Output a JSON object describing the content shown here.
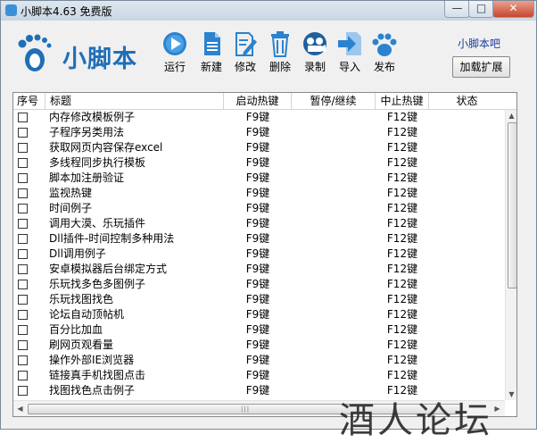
{
  "window": {
    "title": "小脚本4.63 免费版",
    "controls": {
      "minimize": "—",
      "maximize": "□",
      "close": "✕"
    }
  },
  "brand": {
    "logo_text": "小脚本",
    "logo_icon": "footprint-icon",
    "accent_color": "#1f6fb8"
  },
  "toolbar": [
    {
      "label": "运行",
      "icon": "play-icon"
    },
    {
      "label": "新建",
      "icon": "new-document-icon"
    },
    {
      "label": "修改",
      "icon": "edit-icon"
    },
    {
      "label": "删除",
      "icon": "trash-icon"
    },
    {
      "label": "录制",
      "icon": "record-icon"
    },
    {
      "label": "导入",
      "icon": "import-icon"
    },
    {
      "label": "发布",
      "icon": "publish-icon"
    }
  ],
  "side": {
    "link_label": "小脚本吧",
    "extension_button": "加载扩展"
  },
  "table": {
    "columns": [
      "序号",
      "标题",
      "启动热键",
      "暂停/继续",
      "中止热键",
      "状态"
    ],
    "rows": [
      {
        "title": "内存修改模板例子",
        "start": "F9键",
        "pause": "",
        "stop": "F12键",
        "status": ""
      },
      {
        "title": "子程序另类用法",
        "start": "F9键",
        "pause": "",
        "stop": "F12键",
        "status": ""
      },
      {
        "title": "获取网页内容保存excel",
        "start": "F9键",
        "pause": "",
        "stop": "F12键",
        "status": ""
      },
      {
        "title": "多线程同步执行模板",
        "start": "F9键",
        "pause": "",
        "stop": "F12键",
        "status": ""
      },
      {
        "title": "脚本加注册验证",
        "start": "F9键",
        "pause": "",
        "stop": "F12键",
        "status": ""
      },
      {
        "title": "监视热键",
        "start": "F9键",
        "pause": "",
        "stop": "F12键",
        "status": ""
      },
      {
        "title": "时间例子",
        "start": "F9键",
        "pause": "",
        "stop": "F12键",
        "status": ""
      },
      {
        "title": "调用大漠、乐玩插件",
        "start": "F9键",
        "pause": "",
        "stop": "F12键",
        "status": ""
      },
      {
        "title": "Dll插件-时间控制多种用法",
        "start": "F9键",
        "pause": "",
        "stop": "F12键",
        "status": ""
      },
      {
        "title": "Dll调用例子",
        "start": "F9键",
        "pause": "",
        "stop": "F12键",
        "status": ""
      },
      {
        "title": "安卓模拟器后台绑定方式",
        "start": "F9键",
        "pause": "",
        "stop": "F12键",
        "status": ""
      },
      {
        "title": "乐玩找多色多图例子",
        "start": "F9键",
        "pause": "",
        "stop": "F12键",
        "status": ""
      },
      {
        "title": "乐玩找图找色",
        "start": "F9键",
        "pause": "",
        "stop": "F12键",
        "status": ""
      },
      {
        "title": "论坛自动顶帖机",
        "start": "F9键",
        "pause": "",
        "stop": "F12键",
        "status": ""
      },
      {
        "title": "百分比加血",
        "start": "F9键",
        "pause": "",
        "stop": "F12键",
        "status": ""
      },
      {
        "title": "刷网页观看量",
        "start": "F9键",
        "pause": "",
        "stop": "F12键",
        "status": ""
      },
      {
        "title": "操作外部IE浏览器",
        "start": "F9键",
        "pause": "",
        "stop": "F12键",
        "status": ""
      },
      {
        "title": "链接真手机找图点击",
        "start": "F9键",
        "pause": "",
        "stop": "F12键",
        "status": ""
      },
      {
        "title": "找图找色点击例子",
        "start": "F9键",
        "pause": "",
        "stop": "F12键",
        "status": ""
      }
    ]
  },
  "watermark": "酒人论坛"
}
